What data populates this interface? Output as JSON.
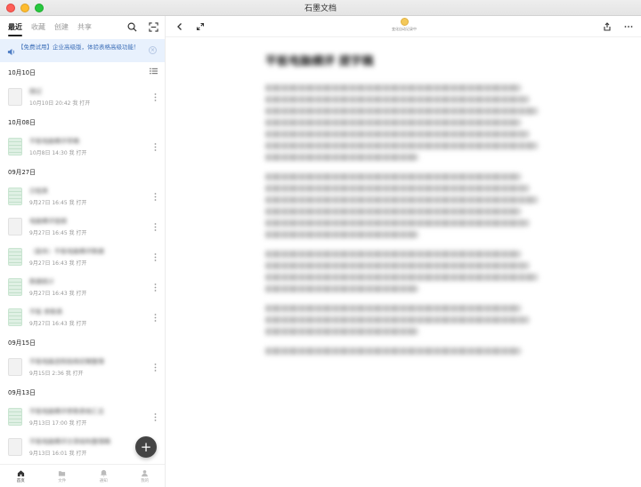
{
  "window": {
    "title": "石墨文档"
  },
  "sidebar": {
    "tabs": [
      "最近",
      "收藏",
      "创建",
      "共享"
    ],
    "active_tab": "最近",
    "banner": {
      "text": "【免费试用】企业高级版，体验表格高级功能！"
    },
    "groups": [
      {
        "date": "10月10日",
        "items": [
          {
            "name": "随记",
            "meta": "10月10日 20:42 我 打开",
            "type": "doc"
          }
        ]
      },
      {
        "date": "10月08日",
        "items": [
          {
            "name": "平板电脑横评草稿",
            "meta": "10月8日 14:30 我 打开",
            "type": "sheet"
          }
        ]
      },
      {
        "date": "09月27日",
        "items": [
          {
            "name": "日程表",
            "meta": "9月27日 16:45 我 打开",
            "type": "sheet"
          },
          {
            "name": "电脑横评提纲",
            "meta": "9月27日 16:45 我 打开",
            "type": "doc"
          },
          {
            "name": "（副本）平板电脑横评数据",
            "meta": "9月27日 16:43 我 打开",
            "type": "sheet"
          },
          {
            "name": "数据统计",
            "meta": "9月27日 16:43 我 打开",
            "type": "sheet"
          },
          {
            "name": "平板 参数表",
            "meta": "9月27日 16:43 我 打开",
            "type": "sheet"
          }
        ]
      },
      {
        "date": "09月15日",
        "items": [
          {
            "name": "平板电脑选购指南初稿整理",
            "meta": "9月15日 2:36 我 打开",
            "type": "doc"
          }
        ]
      },
      {
        "date": "09月13日",
        "items": [
          {
            "name": "平板电脑横评参数表格汇总",
            "meta": "9月13日 17:00 我 打开",
            "type": "sheet"
          },
          {
            "name": "平板电脑横评文章结构整理稿",
            "meta": "9月13日 16:01 我 打开",
            "type": "doc"
          }
        ]
      }
    ],
    "bottom_nav": [
      "首页",
      "文件",
      "通知",
      "我的"
    ]
  },
  "content": {
    "toolbar": {
      "center_label": "变化自动记录中"
    },
    "doc_title": "平板电脑横评 提字稿"
  },
  "colors": {
    "accent": "#3d6fb8",
    "banner_bg": "#e8f1fd",
    "fab": "#444444"
  }
}
